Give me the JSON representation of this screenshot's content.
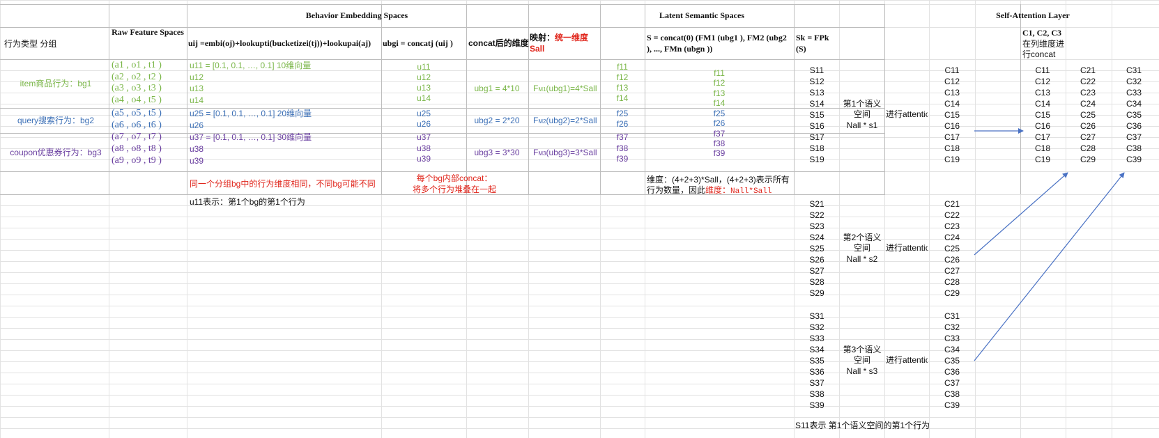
{
  "headers": {
    "behavior_embedding": "Behavior Embedding Spaces",
    "latent_semantic": "Latent Semantic Spaces",
    "self_attention": "Self-Attention Layer",
    "raw_feature": "Raw Feature Spaces",
    "behavior_group": "行为类型  分组",
    "uij_formula": "uij =embi(oj)+lookupti(bucketizei(tj))+lookupai(aj)",
    "ubgi_formula": "ubgi = concatj (uij )",
    "concat_dim": "concat后的维度",
    "mapping_prefix": "映射：",
    "mapping_red": "统一维度",
    "mapping_red2": "Sall",
    "s_formula_1": "S = concat(0) (FM1 (ubg1 ), FM2 (ubg2",
    "s_formula_2": "), ..., FMn (ubgn ))",
    "sk_formula_1": "Sk = FPk",
    "sk_formula_2": "(S)",
    "c_header_1": "C1, C2, C3",
    "c_header_2": "在列维度进",
    "c_header_3": "行concat"
  },
  "groups": [
    {
      "label": "item商品行为：bg1",
      "color": "green"
    },
    {
      "label": "query搜索行为：bg2",
      "color": "blue"
    },
    {
      "label": "coupon优惠券行为：bg3",
      "color": "purple"
    }
  ],
  "raw_features": [
    "(a1 , o1 , t1 )",
    "(a2 , o2 , t2 )",
    "(a3 , o3 , t3 )",
    "(a4 , o4 , t5 )",
    "(a5 , o5 , t5 )",
    "(a6 , o6 , t6 )",
    "(a7 , o7 , t7 )",
    "(a8 , o8 , t8 )",
    "(a9 , o9 , t9 )"
  ],
  "uij_rows": [
    "u11 = [0.1, 0.1, …, 0.1]  10维向量",
    "u12",
    "u13",
    "u14",
    "u25 = [0.1, 0.1, …, 0.1]  20维向量",
    "u26",
    "u37 = [0.1, 0.1, …, 0.1]  30维向量",
    "u38",
    "u39"
  ],
  "ubg_items": [
    "u11",
    "u12",
    "u13",
    "u14",
    "u25",
    "u26",
    "u37",
    "u38",
    "u39"
  ],
  "concat_dims": [
    "ubg1 = 4*10",
    "ubg2 = 2*20",
    "ubg3 = 3*30"
  ],
  "fm_map": [
    {
      "pre": "F",
      "sub": "M1",
      "post": "(ubg1)=4*Sall"
    },
    {
      "pre": "F",
      "sub": "M2",
      "post": "(ubg2)=2*Sall"
    },
    {
      "pre": "F",
      "sub": "M3",
      "post": "(ubg3)=3*Sall"
    }
  ],
  "f_items": [
    "f11",
    "f12",
    "f13",
    "f14",
    "f25",
    "f26",
    "f37",
    "f38",
    "f39"
  ],
  "notes": {
    "dim_note": "同一个分组bg中的行为维度相同，不同bg可能不同",
    "concat_note_1": "每个bg内部concat：",
    "concat_note_2": "将多个行为堆叠在一起",
    "u11_note": "u11表示：第1个bg的第1个行为",
    "latent_note_1": "维度：(4+2+3)*Sall，(4+2+3)表示所有",
    "latent_note_2_prefix": "行为数量，因此",
    "latent_note_2_red": "维度：",
    "latent_note_2_mono": "Nall*Sall",
    "s11_note": "S11表示 第1个语义空间的第1个行为"
  },
  "semantic_spaces": [
    {
      "s_items": [
        "S11",
        "S12",
        "S13",
        "S14",
        "S15",
        "S16",
        "S17",
        "S18",
        "S19"
      ],
      "label_1": "第1个语义",
      "label_2": "空间",
      "label_3": "Nall * s1",
      "attn": "进行attention",
      "c_items": [
        "C11",
        "C12",
        "C13",
        "C14",
        "C15",
        "C16",
        "C17",
        "C18",
        "C19"
      ]
    },
    {
      "s_items": [
        "S21",
        "S22",
        "S23",
        "S24",
        "S25",
        "S26",
        "S27",
        "S28",
        "S29"
      ],
      "label_1": "第2个语义",
      "label_2": "空间",
      "label_3": "Nall * s2",
      "attn": "进行attention",
      "c_items": [
        "C21",
        "C22",
        "C23",
        "C24",
        "C25",
        "C26",
        "C27",
        "C28",
        "C29"
      ]
    },
    {
      "s_items": [
        "S31",
        "S32",
        "S33",
        "S34",
        "S35",
        "S36",
        "S37",
        "S38",
        "S39"
      ],
      "label_1": "第3个语义",
      "label_2": "空间",
      "label_3": "Nall * s3",
      "attn": "进行attention",
      "c_items": [
        "C31",
        "C32",
        "C33",
        "C34",
        "C35",
        "C36",
        "C37",
        "C38",
        "C39"
      ]
    }
  ],
  "concat_result": [
    [
      "C11",
      "C12",
      "C13",
      "C14",
      "C15",
      "C16",
      "C17",
      "C18",
      "C19"
    ],
    [
      "C21",
      "C22",
      "C23",
      "C24",
      "C25",
      "C26",
      "C27",
      "C28",
      "C29"
    ],
    [
      "C31",
      "C32",
      "C33",
      "C34",
      "C35",
      "C36",
      "C37",
      "C38",
      "C39"
    ]
  ],
  "colors": {
    "green": "#7ab648",
    "blue": "#3b6fb6",
    "purple": "#6a3fa0",
    "red": "#e0251b",
    "arrow": "#4a72c4",
    "gridline": "#e2e2e2",
    "border": "#bdbdbd"
  }
}
